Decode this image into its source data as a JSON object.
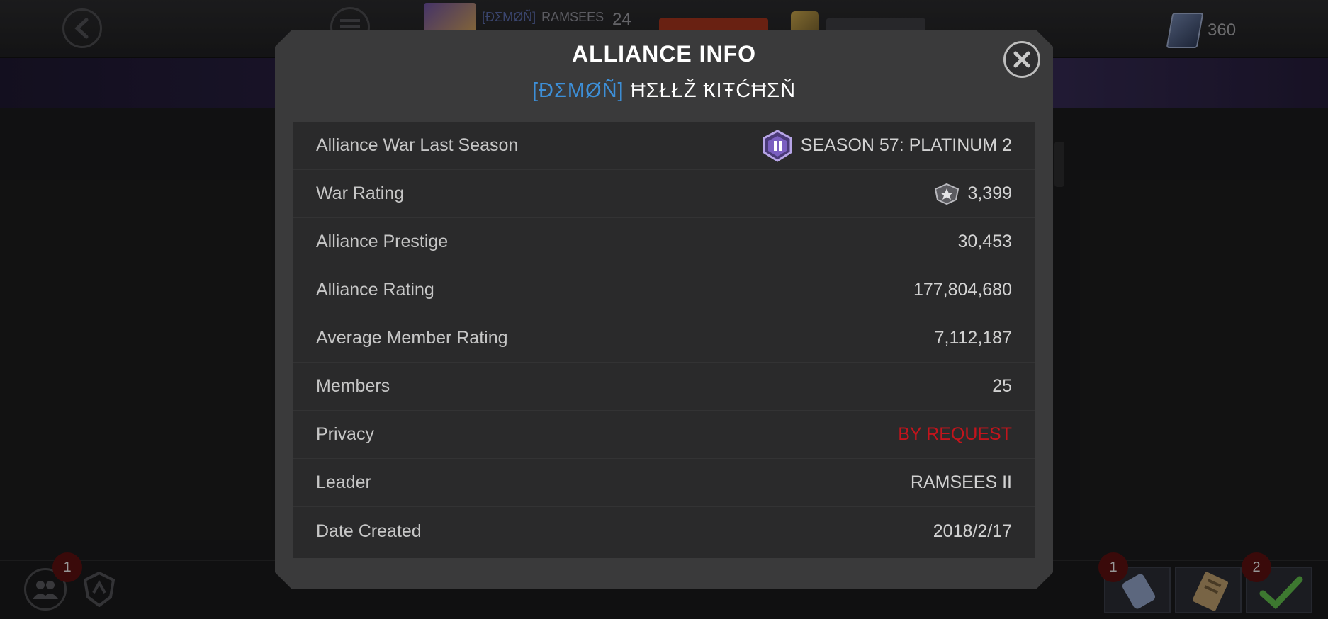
{
  "background": {
    "player_tag": "[ÐΣMØÑ]",
    "player_name": "RAMSEES",
    "level": "24",
    "units_count": "360",
    "alliance_badge_count": "1",
    "bottom_badge_1": "1",
    "bottom_badge_2": "2"
  },
  "modal": {
    "title": "ALLIANCE INFO",
    "alliance_tag": "[ÐΣMØÑ]",
    "alliance_name": "ĦΣŁŁŽ ҞIŦĆĦΣŇ",
    "rows": [
      {
        "label": "Alliance War Last Season",
        "value": "SEASON 57: PLATINUM 2",
        "icon": "platinum-tier-icon"
      },
      {
        "label": "War Rating",
        "value": "3,399",
        "icon": "war-rating-icon"
      },
      {
        "label": "Alliance Prestige",
        "value": "30,453"
      },
      {
        "label": "Alliance Rating",
        "value": "177,804,680"
      },
      {
        "label": "Average Member Rating",
        "value": "7,112,187"
      },
      {
        "label": "Members",
        "value": "25"
      },
      {
        "label": "Privacy",
        "value": "BY REQUEST",
        "color": "#c3141c"
      },
      {
        "label": "Leader",
        "value": "RAMSEES II"
      },
      {
        "label": "Date Created",
        "value": "2018/2/17"
      }
    ]
  },
  "colors": {
    "accent_tag": "#3d8fd8",
    "privacy_red": "#c3141c",
    "modal_bg": "#3a3a3b",
    "table_bg": "#2a2a2b"
  }
}
